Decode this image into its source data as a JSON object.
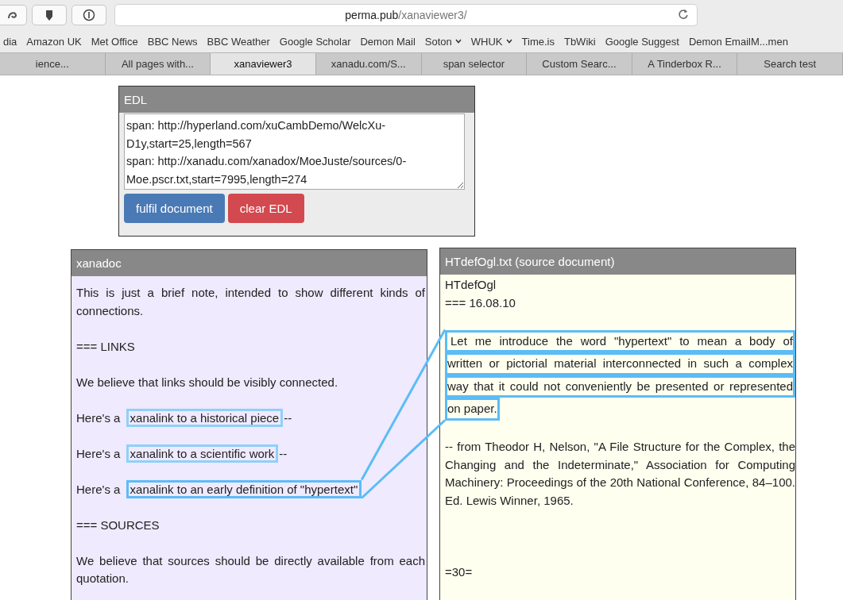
{
  "toolbar": {
    "url": {
      "host": "perma.pub",
      "path": "/xanaviewer3/"
    }
  },
  "bookmarks": [
    {
      "label": "dia",
      "kind": "link"
    },
    {
      "label": "Amazon UK",
      "kind": "link"
    },
    {
      "label": "Met Office",
      "kind": "link"
    },
    {
      "label": "BBC News",
      "kind": "link"
    },
    {
      "label": "BBC Weather",
      "kind": "link"
    },
    {
      "label": "Google Scholar",
      "kind": "link"
    },
    {
      "label": "Demon Mail",
      "kind": "link"
    },
    {
      "label": "Soton",
      "kind": "folder"
    },
    {
      "label": "WHUK",
      "kind": "folder"
    },
    {
      "label": "Time.is",
      "kind": "link"
    },
    {
      "label": "TbWiki",
      "kind": "link"
    },
    {
      "label": "Google Suggest",
      "kind": "link"
    },
    {
      "label": "Demon EmailM...men",
      "kind": "link"
    }
  ],
  "tabs": [
    {
      "label": "ience...",
      "selected": false
    },
    {
      "label": "All pages with...",
      "selected": false
    },
    {
      "label": "xanaviewer3",
      "selected": true
    },
    {
      "label": "xanadu.com/S...",
      "selected": false
    },
    {
      "label": "span selector",
      "selected": false
    },
    {
      "label": "Custom Searc...",
      "selected": false
    },
    {
      "label": "A Tinderbox R...",
      "selected": false
    },
    {
      "label": "Search test",
      "selected": false
    }
  ],
  "edl": {
    "title": "EDL",
    "value": "span: http://hyperland.com/xuCambDemo/WelcXu-D1y,start=25,length=567\nspan: http://xanadu.com/xanadox/MoeJuste/sources/0-Moe.pscr.txt,start=7995,length=274",
    "buttons": [
      {
        "label": "fulfil document",
        "kind": "primary"
      },
      {
        "label": "clear EDL",
        "kind": "danger"
      }
    ]
  },
  "xanadoc": {
    "title": "xanadoc",
    "paragraphs": [
      {
        "kind": "text",
        "text": "This is just a brief note, intended to show different kinds of connections."
      },
      {
        "kind": "text",
        "text": "=== LINKS"
      },
      {
        "kind": "text",
        "text": "We believe that links should be visibly connected."
      },
      {
        "kind": "link",
        "prefix": "Here's a",
        "link": "xanalink to a historical piece",
        "suffix": "--",
        "connected": false
      },
      {
        "kind": "link",
        "prefix": "Here's a",
        "link": "xanalink to a scientific work",
        "suffix": "--",
        "connected": false
      },
      {
        "kind": "link",
        "prefix": "Here's a",
        "link": "xanalink to an early definition of \"hypertext\"",
        "connected": true
      },
      {
        "kind": "text",
        "text": "=== SOURCES"
      },
      {
        "kind": "text",
        "text": "We believe that sources should be directly available from each quotation."
      }
    ]
  },
  "source": {
    "title": "HTdefOgl.txt (source document)",
    "blocks": [
      {
        "kind": "line",
        "text": "HTdefOgl"
      },
      {
        "kind": "line",
        "text": "=== 16.08.10"
      },
      {
        "kind": "highlight",
        "lines": [
          "Let me introduce the word \"hypertext\" to mean a body of",
          "written or pictorial material interconnected in such a complex",
          "way that it could not conveniently be presented or represented",
          "on paper."
        ]
      },
      {
        "kind": "para",
        "text": "-- from Theodor H, Nelson, \"A File Structure for the Complex, the Changing and the Indeterminate,\" Association for Computing Machinery: Proceedings of the 20th National Conference, 84–100. Ed. Lewis Winner, 1965."
      },
      {
        "kind": "end",
        "text": "=30="
      }
    ]
  }
}
